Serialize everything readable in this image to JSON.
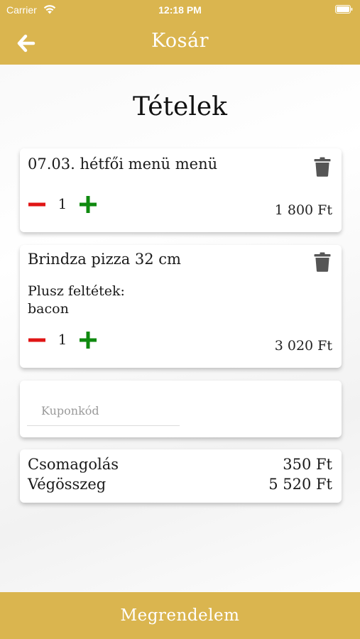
{
  "status_bar": {
    "carrier": "Carrier",
    "time": "12:18 PM"
  },
  "header": {
    "title": "Kosár",
    "back_icon": "arrow-left-icon"
  },
  "page_title": "Tételek",
  "colors": {
    "accent": "#dab54f",
    "minus": "#e01515",
    "plus": "#0f8a0f",
    "trash": "#555555"
  },
  "items": [
    {
      "name": "07.03. hétfői menü menü",
      "quantity": "1",
      "price": "1 800 Ft"
    },
    {
      "name": "Brindza pizza 32 cm",
      "extras_label": "Plusz feltétek:",
      "extras_value": "bacon",
      "quantity": "1",
      "price": "3 020 Ft"
    }
  ],
  "coupon": {
    "placeholder": "Kuponkód",
    "value": ""
  },
  "summary": {
    "packaging_label": "Csomagolás",
    "packaging_value": "350 Ft",
    "total_label": "Végösszeg",
    "total_value": "5 520 Ft"
  },
  "order_button": "Megrendelem"
}
